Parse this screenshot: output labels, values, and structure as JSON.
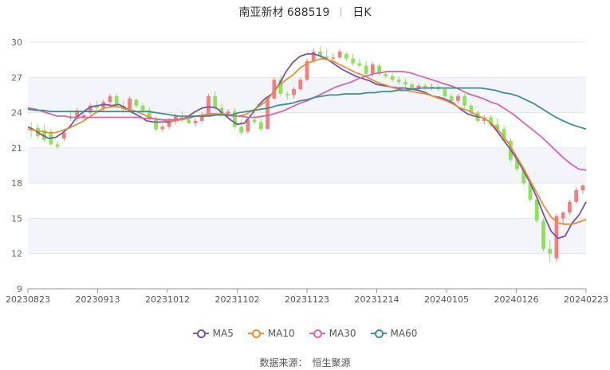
{
  "header": {
    "title": "南亚新材 688519",
    "period": "日K"
  },
  "source": {
    "label": "数据来源：",
    "name": "恒生聚源"
  },
  "chart_data": {
    "type": "candlestick",
    "title": "南亚新材 688519",
    "ylim": [
      9,
      30
    ],
    "yticks": [
      9,
      12,
      15,
      18,
      21,
      24,
      27,
      30
    ],
    "grid": true,
    "legend_position": "bottom",
    "xtick_labels": [
      "20230823",
      "20230913",
      "20231012",
      "20231102",
      "20231123",
      "20231214",
      "20240105",
      "20240126",
      "20240223"
    ],
    "up_color": "#f08080",
    "down_color": "#8fe05a",
    "series": [
      {
        "name": "MA5",
        "color": "#7455a8",
        "values": [
          22.8,
          22.5,
          22.1,
          21.8,
          21.9,
          22.3,
          22.8,
          23.6,
          24.1,
          24.5,
          24.6,
          24.7,
          24.6,
          24.7,
          24.4,
          24.0,
          23.7,
          23.3,
          23.2,
          23.2,
          23.2,
          23.3,
          23.4,
          23.7,
          24.1,
          24.4,
          24.5,
          24.4,
          23.9,
          23.4,
          23.0,
          23.1,
          23.8,
          24.6,
          25.2,
          25.6,
          26.4,
          27.5,
          28.3,
          28.8,
          29.0,
          29.0,
          28.8,
          28.5,
          28.1,
          27.7,
          27.4,
          27.1,
          26.9,
          26.7,
          26.4,
          26.3,
          26.2,
          26.1,
          26.1,
          26.0,
          25.9,
          25.7,
          25.4,
          25.3,
          25.1,
          24.8,
          24.3,
          23.9,
          23.7,
          23.6,
          23.3,
          22.6,
          21.8,
          21.0,
          20.1,
          19.1,
          18.0,
          16.7,
          15.2,
          13.9,
          13.3,
          13.5,
          14.6,
          15.3,
          16.4
        ]
      },
      {
        "name": "MA10",
        "color": "#e39136",
        "values": [
          22.6,
          22.5,
          22.4,
          22.3,
          22.3,
          22.5,
          22.7,
          23.0,
          23.3,
          23.7,
          24.1,
          24.4,
          24.5,
          24.5,
          24.3,
          24.2,
          24.0,
          23.7,
          23.5,
          23.4,
          23.3,
          23.3,
          23.4,
          23.5,
          23.7,
          23.8,
          23.9,
          23.9,
          23.9,
          23.8,
          23.7,
          23.8,
          24.1,
          24.5,
          24.9,
          25.6,
          26.3,
          26.8,
          27.2,
          27.8,
          28.2,
          28.4,
          28.6,
          28.5,
          28.3,
          28.0,
          27.7,
          27.4,
          27.2,
          26.9,
          26.6,
          26.4,
          26.2,
          26.0,
          25.9,
          25.8,
          25.7,
          25.6,
          25.4,
          25.2,
          25.0,
          24.7,
          24.4,
          24.2,
          23.9,
          23.6,
          23.3,
          22.8,
          22.1,
          21.3,
          20.3,
          19.3,
          18.2,
          17.1,
          16.0,
          15.1,
          14.6,
          14.5,
          14.5,
          14.7,
          14.9
        ]
      },
      {
        "name": "MA30",
        "color": "#d664b2",
        "values": [
          24.4,
          24.3,
          24.1,
          23.9,
          23.7,
          23.7,
          23.6,
          23.6,
          23.6,
          23.6,
          23.6,
          23.6,
          23.6,
          23.6,
          23.6,
          23.6,
          23.5,
          23.5,
          23.4,
          23.4,
          23.4,
          23.5,
          23.6,
          23.7,
          23.7,
          23.8,
          23.8,
          23.8,
          23.7,
          23.7,
          23.6,
          23.6,
          23.7,
          23.8,
          24.0,
          24.2,
          24.5,
          24.8,
          25.0,
          25.3,
          25.6,
          25.9,
          26.2,
          26.4,
          26.6,
          26.9,
          27.1,
          27.3,
          27.4,
          27.5,
          27.5,
          27.5,
          27.4,
          27.2,
          27.0,
          26.8,
          26.6,
          26.4,
          26.2,
          25.9,
          25.6,
          25.4,
          25.2,
          24.9,
          24.7,
          24.3,
          23.9,
          23.4,
          22.9,
          22.4,
          21.9,
          21.3,
          20.7,
          20.1,
          19.6,
          19.2,
          19.1
        ]
      },
      {
        "name": "MA60",
        "color": "#3d8f8f",
        "values": [
          24.3,
          24.2,
          24.2,
          24.1,
          24.1,
          24.1,
          24.1,
          24.1,
          24.1,
          24.1,
          24.1,
          24.1,
          24.1,
          24.1,
          24.1,
          24.1,
          24.1,
          24.0,
          23.9,
          23.8,
          23.7,
          23.7,
          23.7,
          23.7,
          23.7,
          23.8,
          23.8,
          23.8,
          24.0,
          24.1,
          24.2,
          24.3,
          24.4,
          24.6,
          24.7,
          24.8,
          25.0,
          25.1,
          25.3,
          25.4,
          25.5,
          25.5,
          25.6,
          25.6,
          25.6,
          25.7,
          25.7,
          25.8,
          25.8,
          25.9,
          25.9,
          26.0,
          26.1,
          26.1,
          26.1,
          26.1,
          26.1,
          26.1,
          26.1,
          26.1,
          26.1,
          26.0,
          25.9,
          25.7,
          25.6,
          25.4,
          25.1,
          24.8,
          24.4,
          24.0,
          23.6,
          23.3,
          23.0,
          22.8,
          22.6
        ]
      }
    ],
    "ohlc": [
      [
        22.6,
        23.2,
        21.9,
        22.5
      ],
      [
        22.7,
        23.0,
        21.8,
        22.0
      ],
      [
        22.5,
        23.0,
        21.5,
        21.7
      ],
      [
        22.3,
        22.6,
        21.2,
        21.3
      ],
      [
        21.3,
        21.6,
        20.9,
        21.1
      ],
      [
        21.8,
        22.6,
        21.6,
        22.3
      ],
      [
        23.6,
        24.2,
        23.3,
        23.5
      ],
      [
        23.5,
        24.4,
        23.3,
        24.2
      ],
      [
        23.6,
        24.0,
        23.4,
        23.8
      ],
      [
        24.0,
        24.8,
        23.8,
        24.6
      ],
      [
        24.6,
        25.0,
        24.2,
        24.4
      ],
      [
        24.4,
        25.1,
        24.1,
        24.9
      ],
      [
        24.9,
        25.6,
        24.7,
        25.4
      ],
      [
        25.4,
        25.6,
        24.4,
        24.6
      ],
      [
        24.6,
        25.0,
        24.0,
        24.3
      ],
      [
        24.3,
        25.4,
        24.1,
        25.2
      ],
      [
        25.1,
        25.2,
        24.4,
        24.6
      ],
      [
        24.6,
        24.8,
        23.9,
        24.2
      ],
      [
        24.2,
        24.4,
        23.3,
        23.5
      ],
      [
        23.5,
        23.7,
        22.4,
        22.6
      ],
      [
        22.6,
        23.0,
        22.4,
        22.8
      ],
      [
        22.8,
        23.5,
        22.6,
        23.3
      ],
      [
        23.3,
        23.9,
        23.0,
        23.7
      ],
      [
        23.6,
        24.1,
        23.2,
        23.4
      ],
      [
        23.4,
        23.8,
        23.0,
        23.1
      ],
      [
        23.1,
        23.5,
        22.8,
        23.3
      ],
      [
        23.3,
        24.0,
        23.1,
        23.8
      ],
      [
        23.8,
        25.6,
        23.7,
        25.4
      ],
      [
        25.4,
        25.8,
        24.2,
        24.4
      ],
      [
        24.4,
        24.7,
        23.7,
        23.9
      ],
      [
        23.9,
        24.3,
        23.6,
        24.1
      ],
      [
        24.1,
        24.4,
        22.6,
        22.8
      ],
      [
        22.8,
        23.4,
        22.1,
        22.3
      ],
      [
        22.4,
        23.6,
        22.2,
        23.4
      ],
      [
        23.4,
        24.1,
        23.0,
        23.2
      ],
      [
        23.2,
        23.8,
        22.4,
        22.6
      ],
      [
        22.6,
        25.4,
        22.6,
        25.2
      ],
      [
        25.2,
        27.0,
        25.1,
        26.8
      ],
      [
        26.8,
        27.2,
        25.4,
        25.6
      ],
      [
        25.6,
        25.8,
        25.1,
        25.5
      ],
      [
        25.5,
        26.2,
        25.2,
        26.0
      ],
      [
        26.0,
        27.0,
        25.8,
        26.8
      ],
      [
        26.8,
        28.6,
        26.7,
        28.4
      ],
      [
        28.4,
        29.5,
        28.2,
        29.2
      ],
      [
        29.2,
        29.6,
        28.6,
        28.8
      ],
      [
        28.8,
        29.4,
        28.4,
        28.6
      ],
      [
        28.6,
        29.0,
        28.3,
        28.7
      ],
      [
        28.7,
        29.4,
        28.6,
        29.2
      ],
      [
        29.0,
        29.1,
        28.4,
        28.6
      ],
      [
        28.6,
        29.0,
        28.0,
        28.2
      ],
      [
        28.2,
        28.6,
        27.8,
        28.0
      ],
      [
        28.0,
        28.4,
        27.1,
        27.3
      ],
      [
        27.3,
        28.3,
        27.1,
        28.1
      ],
      [
        28.0,
        28.2,
        27.1,
        27.3
      ],
      [
        27.3,
        27.6,
        26.9,
        27.1
      ],
      [
        27.1,
        27.4,
        26.6,
        26.8
      ],
      [
        26.8,
        27.1,
        26.4,
        26.6
      ],
      [
        26.6,
        26.9,
        26.2,
        26.4
      ],
      [
        26.4,
        26.6,
        25.8,
        26.0
      ],
      [
        26.0,
        26.5,
        25.8,
        26.3
      ],
      [
        26.3,
        26.5,
        25.9,
        26.1
      ],
      [
        26.1,
        26.5,
        25.9,
        26.2
      ],
      [
        26.2,
        26.4,
        25.8,
        26.0
      ],
      [
        26.0,
        26.2,
        25.2,
        25.4
      ],
      [
        25.4,
        25.6,
        24.8,
        25.0
      ],
      [
        25.0,
        25.6,
        24.8,
        25.4
      ],
      [
        25.4,
        25.6,
        24.4,
        24.6
      ],
      [
        24.6,
        24.8,
        23.8,
        24.0
      ],
      [
        24.0,
        24.2,
        23.1,
        23.3
      ],
      [
        23.3,
        23.8,
        23.0,
        23.6
      ],
      [
        23.6,
        23.8,
        22.8,
        23.0
      ],
      [
        23.0,
        23.5,
        22.4,
        22.6
      ],
      [
        22.6,
        22.9,
        21.4,
        21.6
      ],
      [
        21.6,
        21.8,
        19.8,
        20.0
      ],
      [
        20.0,
        20.2,
        19.0,
        19.2
      ],
      [
        19.2,
        19.4,
        17.8,
        18.0
      ],
      [
        18.0,
        18.2,
        16.4,
        16.6
      ],
      [
        16.6,
        16.8,
        14.6,
        14.8
      ],
      [
        14.8,
        15.0,
        12.2,
        12.4
      ],
      [
        12.4,
        13.2,
        11.3,
        12.0
      ],
      [
        11.6,
        15.4,
        11.3,
        15.2
      ],
      [
        15.0,
        15.6,
        14.4,
        15.5
      ],
      [
        15.5,
        16.6,
        15.3,
        16.4
      ],
      [
        16.4,
        17.6,
        16.2,
        17.4
      ],
      [
        17.4,
        17.9,
        17.1,
        17.8
      ]
    ]
  }
}
